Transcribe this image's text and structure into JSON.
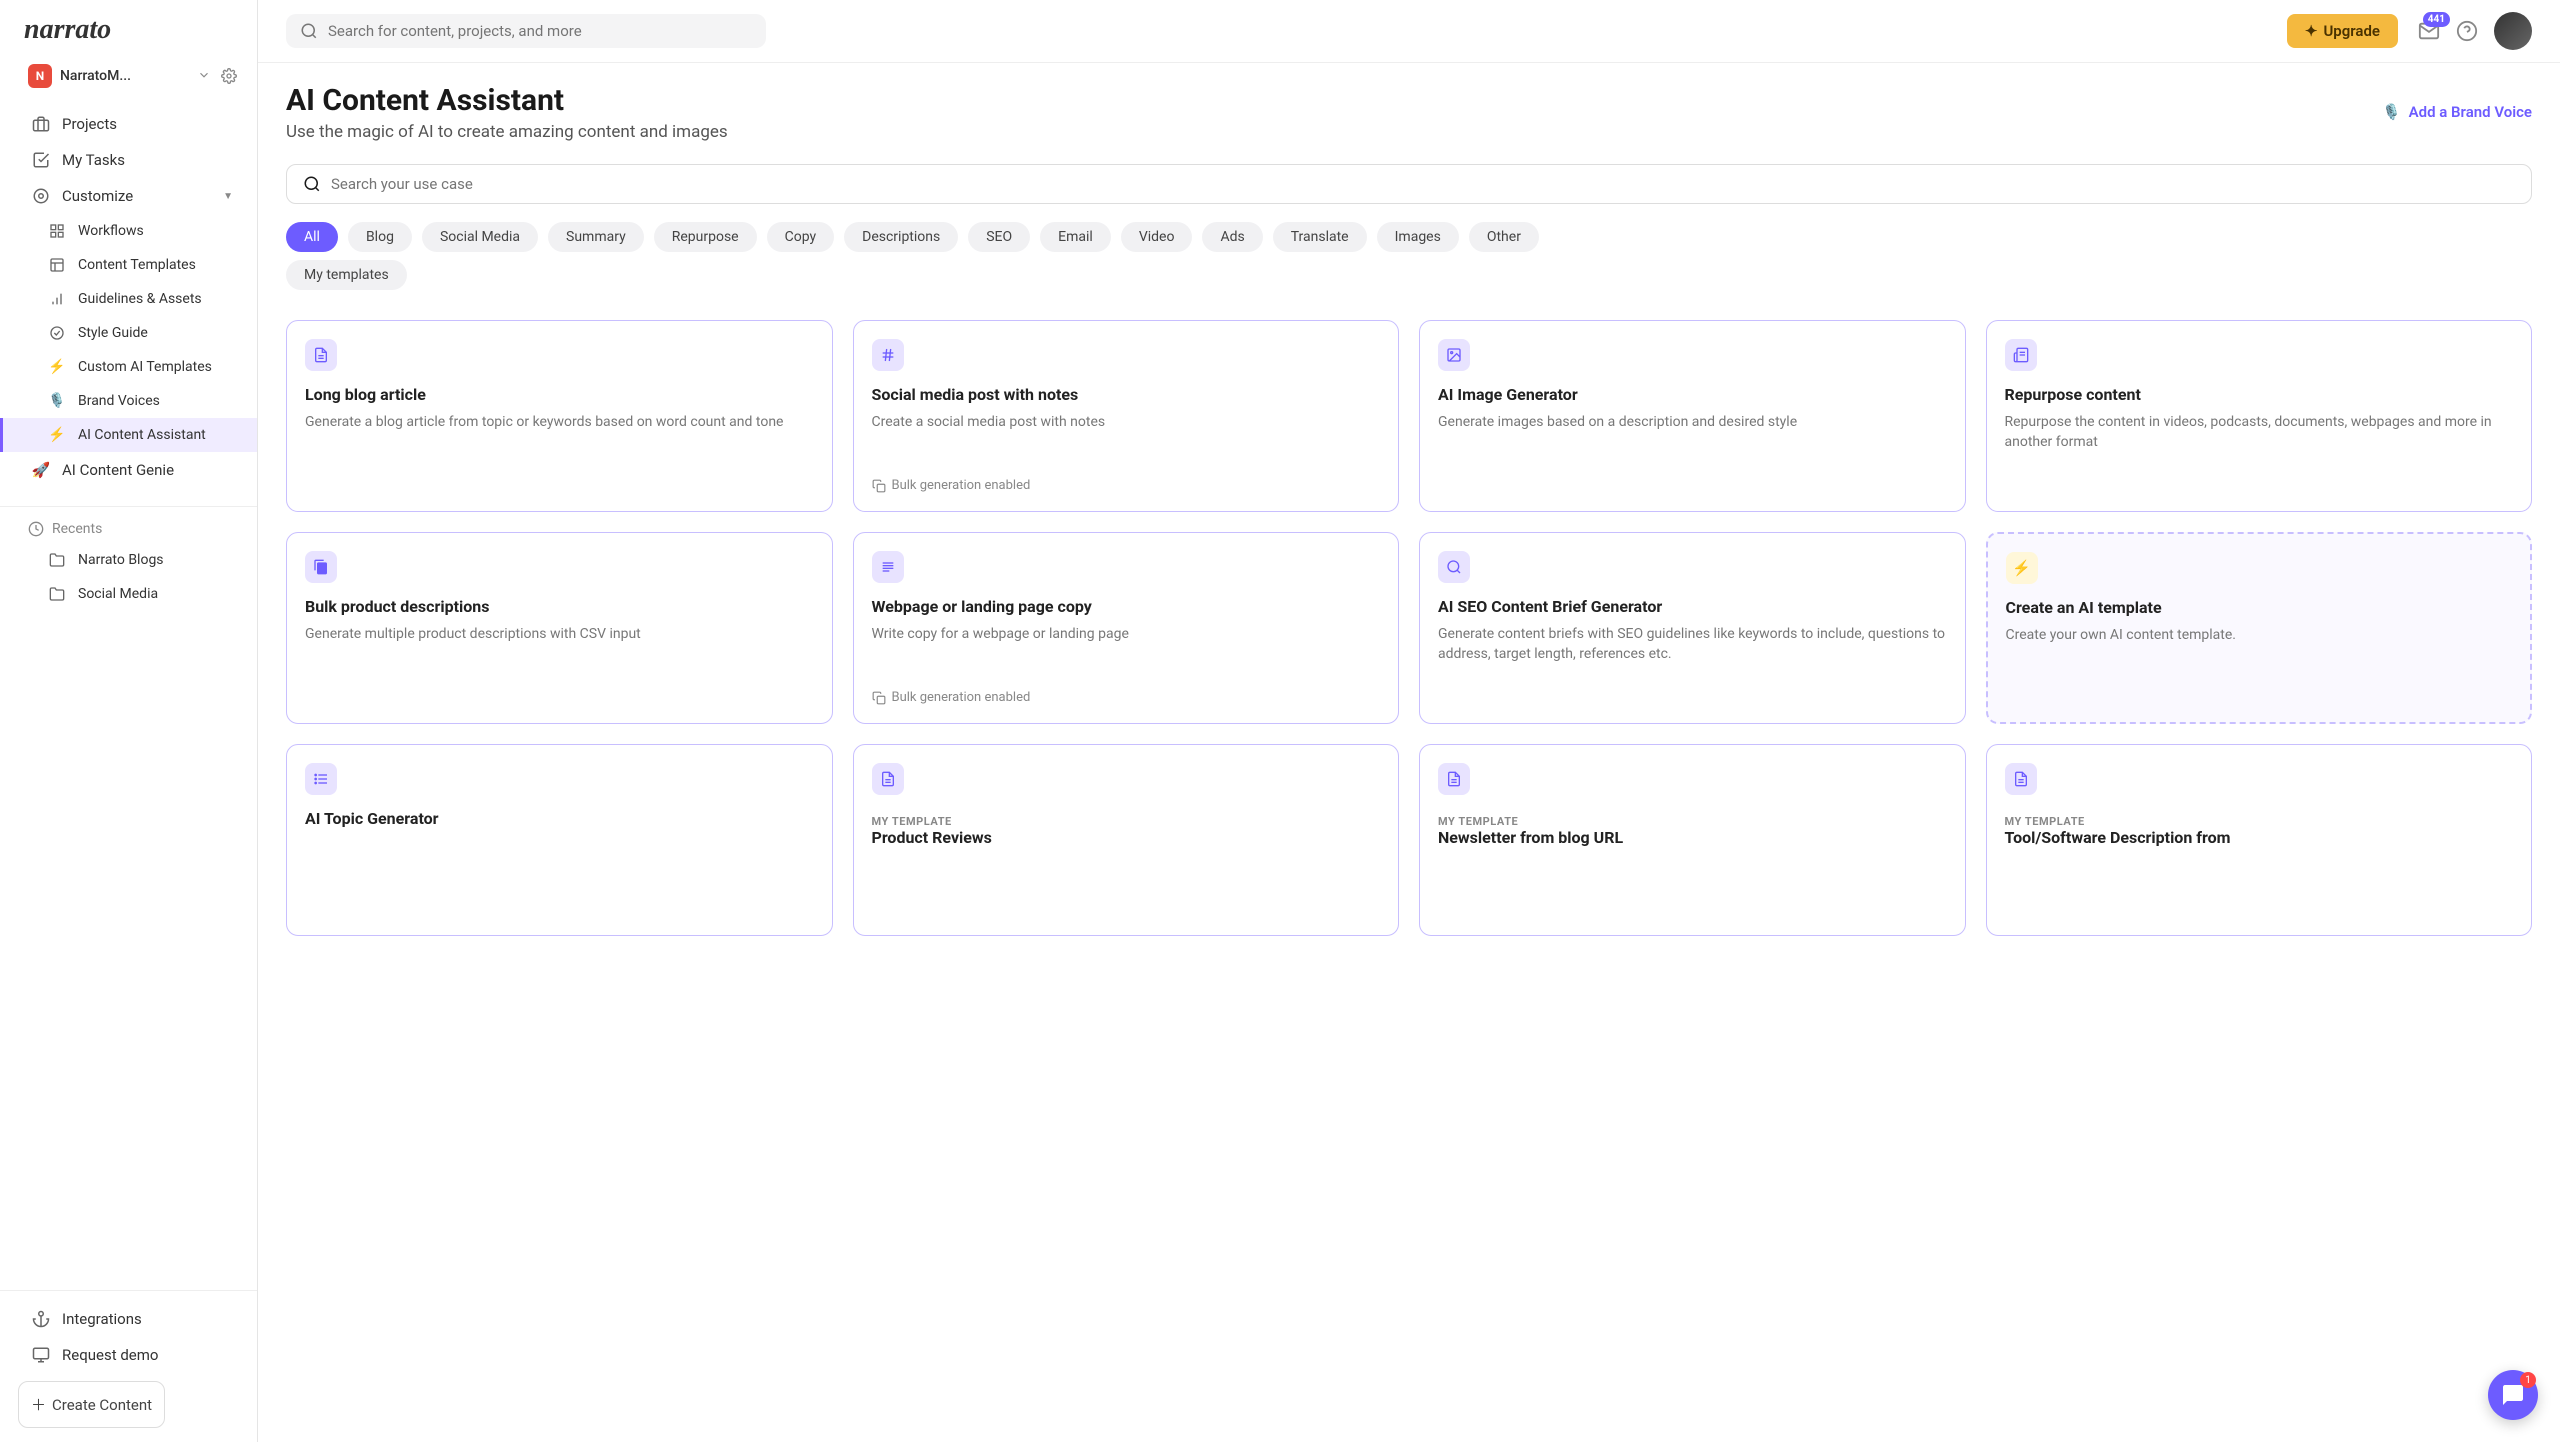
{
  "brand": "narrato",
  "workspace": {
    "badge": "N",
    "name": "NarratoM..."
  },
  "nav": {
    "projects": "Projects",
    "my_tasks": "My Tasks",
    "customize": "Customize",
    "workflows": "Workflows",
    "content_templates": "Content Templates",
    "guidelines": "Guidelines & Assets",
    "style_guide": "Style Guide",
    "custom_ai": "Custom AI Templates",
    "brand_voices": "Brand Voices",
    "ai_assistant": "AI Content Assistant",
    "ai_genie": "AI Content Genie"
  },
  "recents": {
    "heading": "Recents",
    "items": [
      "Narrato Blogs",
      "Social Media"
    ]
  },
  "bottom_nav": {
    "integrations": "Integrations",
    "request_demo": "Request demo",
    "create_content": "Create Content"
  },
  "topbar": {
    "search_placeholder": "Search for content, projects, and more",
    "upgrade": "Upgrade",
    "notif_count": "441"
  },
  "page": {
    "title": "AI Content Assistant",
    "subtitle": "Use the magic of AI to create amazing content and images",
    "brand_voice": "Add a Brand Voice",
    "use_search_placeholder": "Search your use case"
  },
  "chips": [
    "All",
    "Blog",
    "Social Media",
    "Summary",
    "Repurpose",
    "Copy",
    "Descriptions",
    "SEO",
    "Email",
    "Video",
    "Ads",
    "Translate",
    "Images",
    "Other"
  ],
  "chip_secondary": "My templates",
  "cards": [
    {
      "title": "Long blog article",
      "desc": "Generate a blog article from topic or keywords based on word count and tone",
      "icon": "document-icon"
    },
    {
      "title": "Social media post with notes",
      "desc": "Create a social media post with notes",
      "icon": "hash-icon",
      "footer": "Bulk generation enabled"
    },
    {
      "title": "AI Image Generator",
      "desc": "Generate images based on a description and desired style",
      "icon": "image-icon"
    },
    {
      "title": "Repurpose content",
      "desc": "Repurpose the content in videos, podcasts, documents, webpages and more in another format",
      "icon": "news-icon"
    },
    {
      "title": "Bulk product descriptions",
      "desc": "Generate multiple product descriptions with CSV input",
      "icon": "file-copy-icon"
    },
    {
      "title": "Webpage or landing page copy",
      "desc": "Write copy for a webpage or landing page",
      "icon": "lines-icon",
      "footer": "Bulk generation enabled"
    },
    {
      "title": "AI SEO Content Brief Generator",
      "desc": "Generate content briefs with SEO guidelines like keywords to include, questions to address, target length, references etc.",
      "icon": "magnify-icon"
    },
    {
      "title": "Create an AI template",
      "desc": "Create your own AI content template.",
      "icon": "bolt-icon",
      "dashed": true
    },
    {
      "title": "AI Topic Generator",
      "desc": "",
      "icon": "list-icon"
    },
    {
      "title": "Product Reviews",
      "desc": "",
      "icon": "document-icon",
      "tag": "MY TEMPLATE"
    },
    {
      "title": "Newsletter from blog URL",
      "desc": "",
      "icon": "document-icon",
      "tag": "MY TEMPLATE"
    },
    {
      "title": "Tool/Software Description from",
      "desc": "",
      "icon": "document-icon",
      "tag": "MY TEMPLATE"
    }
  ],
  "chat": {
    "count": "1"
  }
}
